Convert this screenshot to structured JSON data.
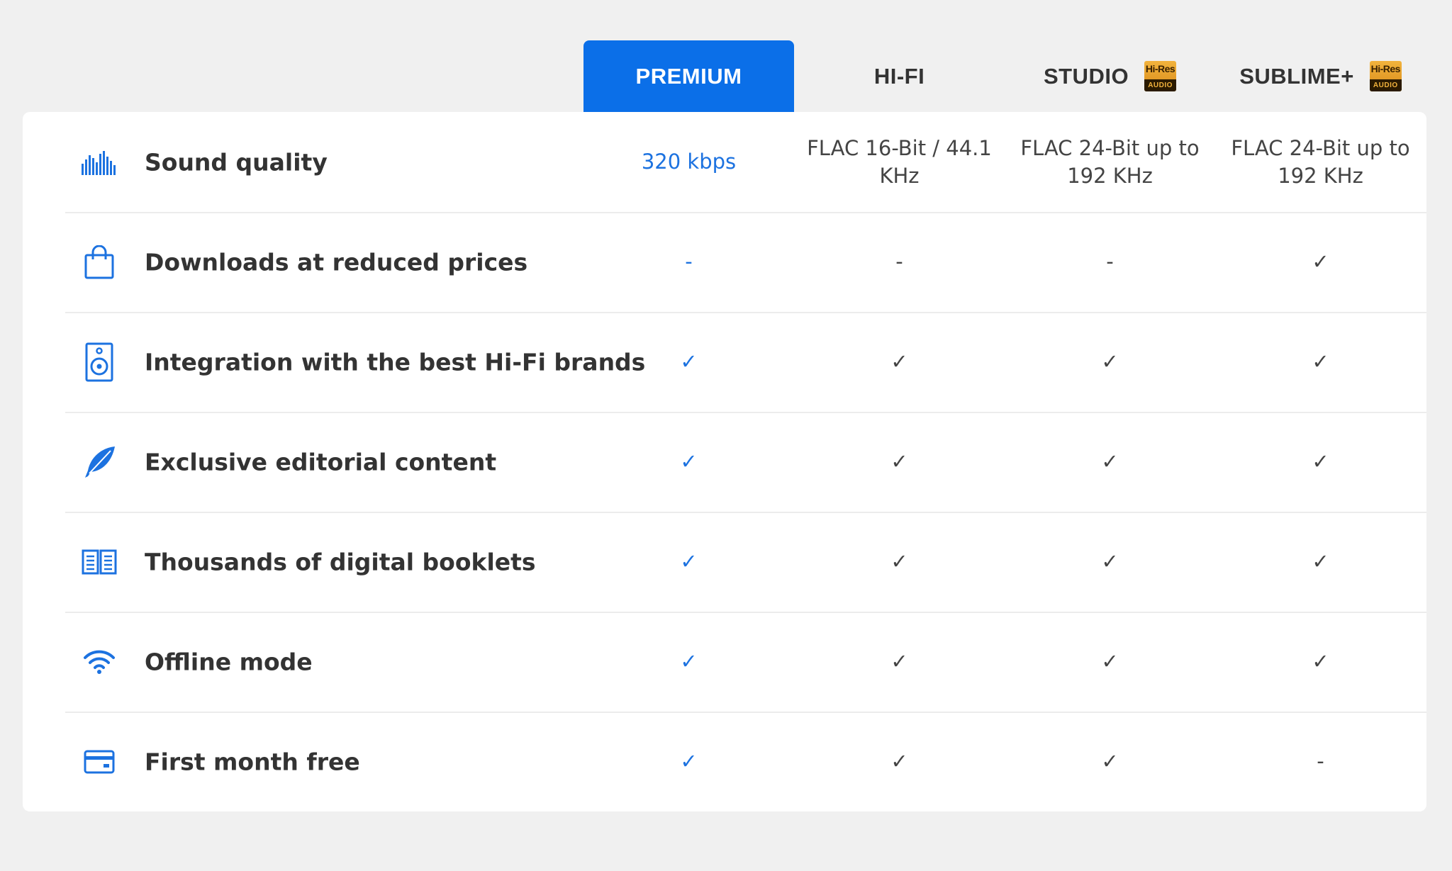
{
  "plans": [
    {
      "name": "PREMIUM",
      "active": true,
      "hires": false
    },
    {
      "name": "HI-FI",
      "active": false,
      "hires": false
    },
    {
      "name": "STUDIO",
      "active": false,
      "hires": true
    },
    {
      "name": "SUBLIME+",
      "active": false,
      "hires": true
    }
  ],
  "hires_badge": {
    "top": "Hi-Res",
    "bottom": "AUDIO"
  },
  "accent_color": "#0b6fe8",
  "features": [
    {
      "label": "Sound quality",
      "icon": "equalizer-icon",
      "values": [
        "320 kbps",
        "FLAC 16-Bit / 44.1 KHz",
        "FLAC 24-Bit up to 192 KHz",
        "FLAC 24-Bit up to 192 KHz"
      ]
    },
    {
      "label": "Downloads at reduced prices",
      "icon": "shopping-bag-icon",
      "values": [
        "-",
        "-",
        "-",
        "✓"
      ]
    },
    {
      "label": "Integration with the best Hi-Fi brands",
      "icon": "speaker-icon",
      "values": [
        "✓",
        "✓",
        "✓",
        "✓"
      ]
    },
    {
      "label": "Exclusive editorial content",
      "icon": "feather-icon",
      "values": [
        "✓",
        "✓",
        "✓",
        "✓"
      ]
    },
    {
      "label": "Thousands of digital booklets",
      "icon": "book-icon",
      "values": [
        "✓",
        "✓",
        "✓",
        "✓"
      ]
    },
    {
      "label": "Offline mode",
      "icon": "wifi-icon",
      "values": [
        "✓",
        "✓",
        "✓",
        "✓"
      ]
    },
    {
      "label": "First month free",
      "icon": "credit-card-icon",
      "values": [
        "✓",
        "✓",
        "✓",
        "-"
      ]
    }
  ]
}
